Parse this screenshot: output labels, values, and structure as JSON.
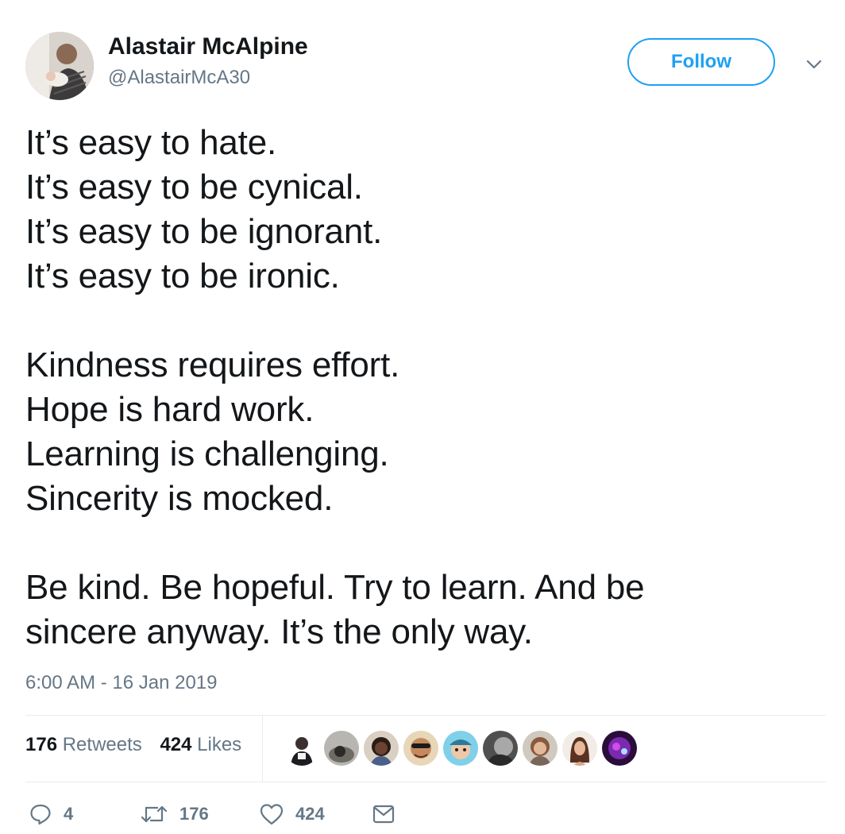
{
  "user": {
    "display_name": "Alastair McAlpine",
    "handle": "@AlastairMcA30"
  },
  "follow_label": "Follow",
  "tweet": {
    "stanzas": [
      [
        "It’s easy to hate.",
        "It’s easy to be cynical.",
        "It’s easy to be ignorant.",
        "It’s easy to be ironic."
      ],
      [
        "Kindness requires effort.",
        "Hope is hard work.",
        "Learning is challenging.",
        "Sincerity is mocked."
      ],
      [
        "Be kind. Be hopeful. Try to learn. And be",
        "sincere anyway. It’s the only way."
      ]
    ],
    "timestamp": "6:00 AM - 16 Jan 2019"
  },
  "stats": {
    "retweets_count": "176",
    "retweets_label": "Retweets",
    "likes_count": "424",
    "likes_label": "Likes"
  },
  "actions": {
    "reply_count": "4",
    "retweet_count": "176",
    "like_count": "424"
  },
  "colors": {
    "accent": "#1da1f2",
    "text": "#14171a",
    "muted": "#657786",
    "divider": "#e6ecf0"
  },
  "icons": [
    "chevron-down-icon",
    "reply-icon",
    "retweet-icon",
    "heart-icon",
    "envelope-icon"
  ]
}
